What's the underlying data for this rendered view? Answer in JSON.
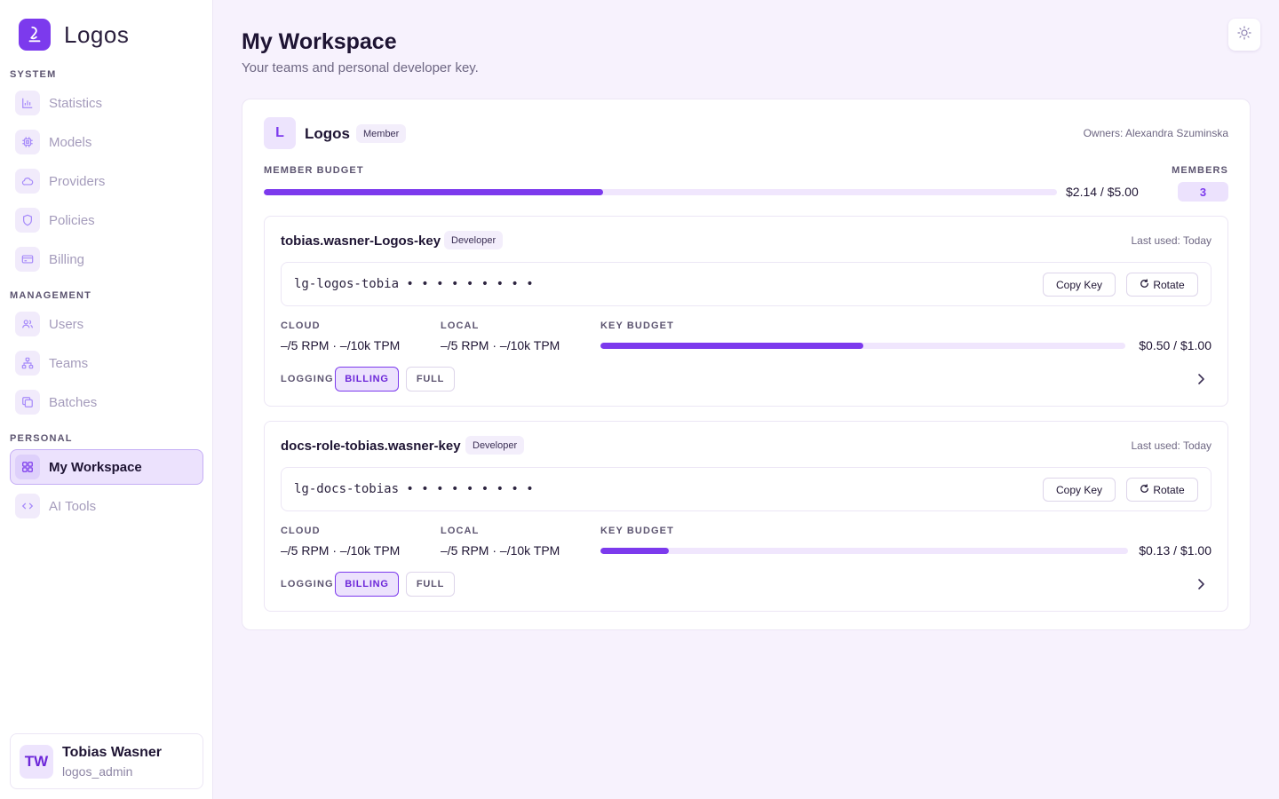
{
  "app": {
    "name": "Logos"
  },
  "sidebar": {
    "sections": {
      "system": "SYSTEM",
      "management": "MANAGEMENT",
      "personal": "PERSONAL"
    },
    "items": [
      {
        "label": "Statistics",
        "icon": "bar-chart-icon"
      },
      {
        "label": "Models",
        "icon": "chip-icon"
      },
      {
        "label": "Providers",
        "icon": "cloud-icon"
      },
      {
        "label": "Policies",
        "icon": "shield-icon"
      },
      {
        "label": "Billing",
        "icon": "credit-card-icon"
      },
      {
        "label": "Users",
        "icon": "users-icon"
      },
      {
        "label": "Teams",
        "icon": "hierarchy-icon"
      },
      {
        "label": "Batches",
        "icon": "copy-icon"
      },
      {
        "label": "My Workspace",
        "icon": "grid-icon",
        "active": true
      },
      {
        "label": "AI Tools",
        "icon": "code-icon"
      }
    ]
  },
  "user": {
    "initials": "TW",
    "name": "Tobias Wasner",
    "role": "logos_admin"
  },
  "page": {
    "title": "My Workspace",
    "subtitle": "Your teams and personal developer key."
  },
  "team": {
    "initial": "L",
    "name": "Logos",
    "badge": "Member",
    "owners": "Owners: Alexandra Szuminska",
    "budget_label": "MEMBER BUDGET",
    "budget_text": "$2.14 / $5.00",
    "budget_fraction": 0.428,
    "members_label": "MEMBERS",
    "members_count": "3"
  },
  "keys": [
    {
      "name": "tobias.wasner-Logos-key",
      "role": "Developer",
      "last_used": "Last used: Today",
      "masked_key": "lg-logos-tobia • • • • • • • • •",
      "copy_label": "Copy Key",
      "rotate_label": "Rotate",
      "cloud_label": "CLOUD",
      "cloud_value": "–/5 RPM · –/10k TPM",
      "local_label": "LOCAL",
      "local_value": "–/5 RPM · –/10k TPM",
      "key_budget_label": "KEY BUDGET",
      "key_budget_text": "$0.50 / $1.00",
      "key_budget_fraction": 0.5,
      "logging_label": "LOGGING",
      "log_billing": "BILLING",
      "log_full": "FULL"
    },
    {
      "name": "docs-role-tobias.wasner-key",
      "role": "Developer",
      "last_used": "Last used: Today",
      "masked_key": "lg-docs-tobias • • • • • • • • •",
      "copy_label": "Copy Key",
      "rotate_label": "Rotate",
      "cloud_label": "CLOUD",
      "cloud_value": "–/5 RPM · –/10k TPM",
      "local_label": "LOCAL",
      "local_value": "–/5 RPM · –/10k TPM",
      "key_budget_label": "KEY BUDGET",
      "key_budget_text": "$0.13 / $1.00",
      "key_budget_fraction": 0.13,
      "logging_label": "LOGGING",
      "log_billing": "BILLING",
      "log_full": "FULL"
    }
  ],
  "colors": {
    "accent": "#7c3aed",
    "background": "#f7f2fd",
    "track": "#f0e6fd"
  }
}
